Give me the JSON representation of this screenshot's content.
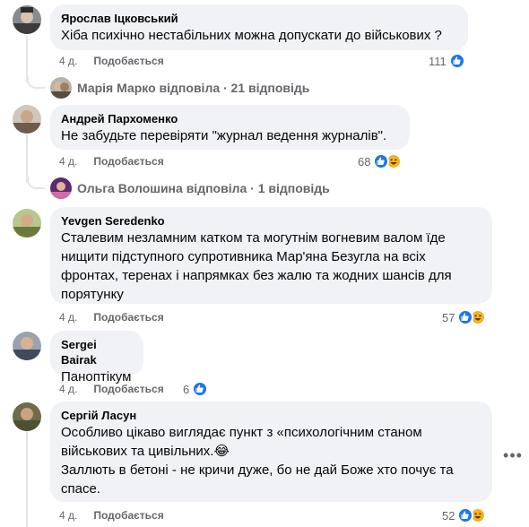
{
  "comments": [
    {
      "author": "Ярослав Іцковський",
      "text": "Хіба психічно нестабільних можна допускати до військових ?",
      "time": "4 д.",
      "like_label": "Подобається",
      "reaction_count": "111",
      "reactions": [
        "like"
      ],
      "reply": {
        "text": "Марія Марко відповіла · 21 відповідь"
      }
    },
    {
      "author": "Андрей Пархоменко",
      "text": "Не забудьте перевіряти \"журнал ведення журналів\".",
      "time": "4 д.",
      "like_label": "Подобається",
      "reaction_count": "68",
      "reactions": [
        "like",
        "haha"
      ],
      "reply": {
        "text": "Ольга Волошина відповіла · 1 відповідь"
      }
    },
    {
      "author": "Yevgen Seredenko",
      "text": "Сталевим незламним катком та могутнім вогневим валом їде\nнищити підступного супротивника Мар'яна Безугла на всіх\nфронтах, теренах і напрямках без жалю та жодних шансів для\nпорятунку",
      "time": "4 д.",
      "like_label": "Подобається",
      "reaction_count": "57",
      "reactions": [
        "like",
        "haha"
      ]
    },
    {
      "author": "Sergei Bairak",
      "text": "Паноптікум",
      "time": "4 д.",
      "like_label": "Подобається",
      "reaction_count": "6",
      "reactions": [
        "like"
      ]
    },
    {
      "author": "Сергій Ласун",
      "text": "Особливо цікаво виглядає пункт з «психологічним станом\nвійськових та цивільних.😂\nЗаллють в бетоні - не кричи дуже, бо не дай Боже хто почує та\nспасе.",
      "time": "4 д.",
      "like_label": "Подобається",
      "reaction_count": "52",
      "reactions": [
        "like",
        "haha"
      ]
    }
  ],
  "more_options_icon": "more-horizontal-icon",
  "colors": {
    "bubble": "#f0f2f5",
    "meta_text": "#65676b",
    "like_blue": "#1877f2",
    "haha_yellow": "#f7b125",
    "thread_line": "#e4e6eb"
  }
}
